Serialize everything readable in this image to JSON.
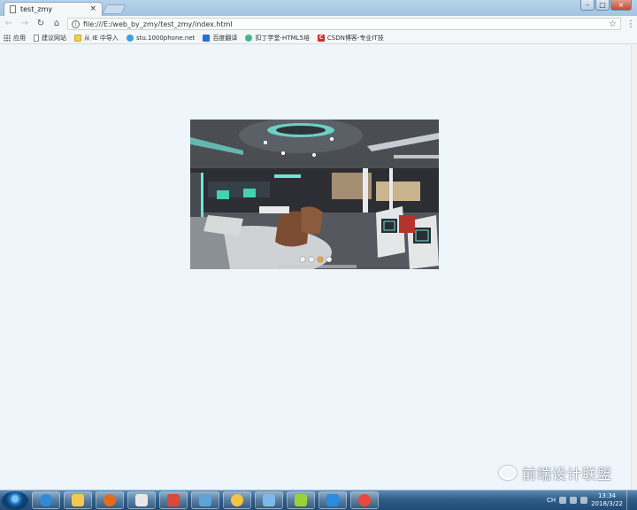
{
  "browser": {
    "tab_title": "test_zmy",
    "tab_close": "×",
    "url": "file:///E:/web_by_zmy/test_zmy/index.html",
    "bookmarks": [
      {
        "label": "应用",
        "icon": "apps-icon"
      },
      {
        "label": "建议网站",
        "icon": "page-icon"
      },
      {
        "label": "从 IE 中导入",
        "icon": "folder-icon"
      },
      {
        "label": "stu.1000phone.net",
        "icon": "stu-icon"
      },
      {
        "label": "百度翻译",
        "icon": "baidu-translate-icon"
      },
      {
        "label": "扣丁学堂-HTML5培",
        "icon": "qianfeng-icon"
      },
      {
        "label": "CSDN博客-专业IT技",
        "icon": "csdn-icon"
      }
    ]
  },
  "page": {
    "carousel": {
      "slide_count": 4,
      "active_index": 2,
      "slide_description_icon": "tech-office-interior-image"
    }
  },
  "watermark": {
    "text": "前端设计联盟",
    "icon": "wechat-icon"
  },
  "taskbar": {
    "items": [
      {
        "icon": "ie-icon",
        "color": "#2f8bd6"
      },
      {
        "icon": "folder-icon",
        "color": "#f0c94e"
      },
      {
        "icon": "firefox-icon",
        "color": "#e76b1c"
      },
      {
        "icon": "app-icon",
        "color": "#e8e8e8"
      },
      {
        "icon": "hbuilder-icon",
        "color": "#d94a3a"
      },
      {
        "icon": "monitor-icon",
        "color": "#5fa4d8"
      },
      {
        "icon": "weather-icon",
        "color": "#f4c542"
      },
      {
        "icon": "gallery-icon",
        "color": "#7cb9e8"
      },
      {
        "icon": "green-app-icon",
        "color": "#9ad13a"
      },
      {
        "icon": "wps-icon",
        "color": "#2b8be0"
      },
      {
        "icon": "chrome-icon",
        "color": "#e9483a"
      }
    ],
    "tray_lang": "CH",
    "clock_time": "13:34",
    "clock_date": "2018/3/22"
  }
}
